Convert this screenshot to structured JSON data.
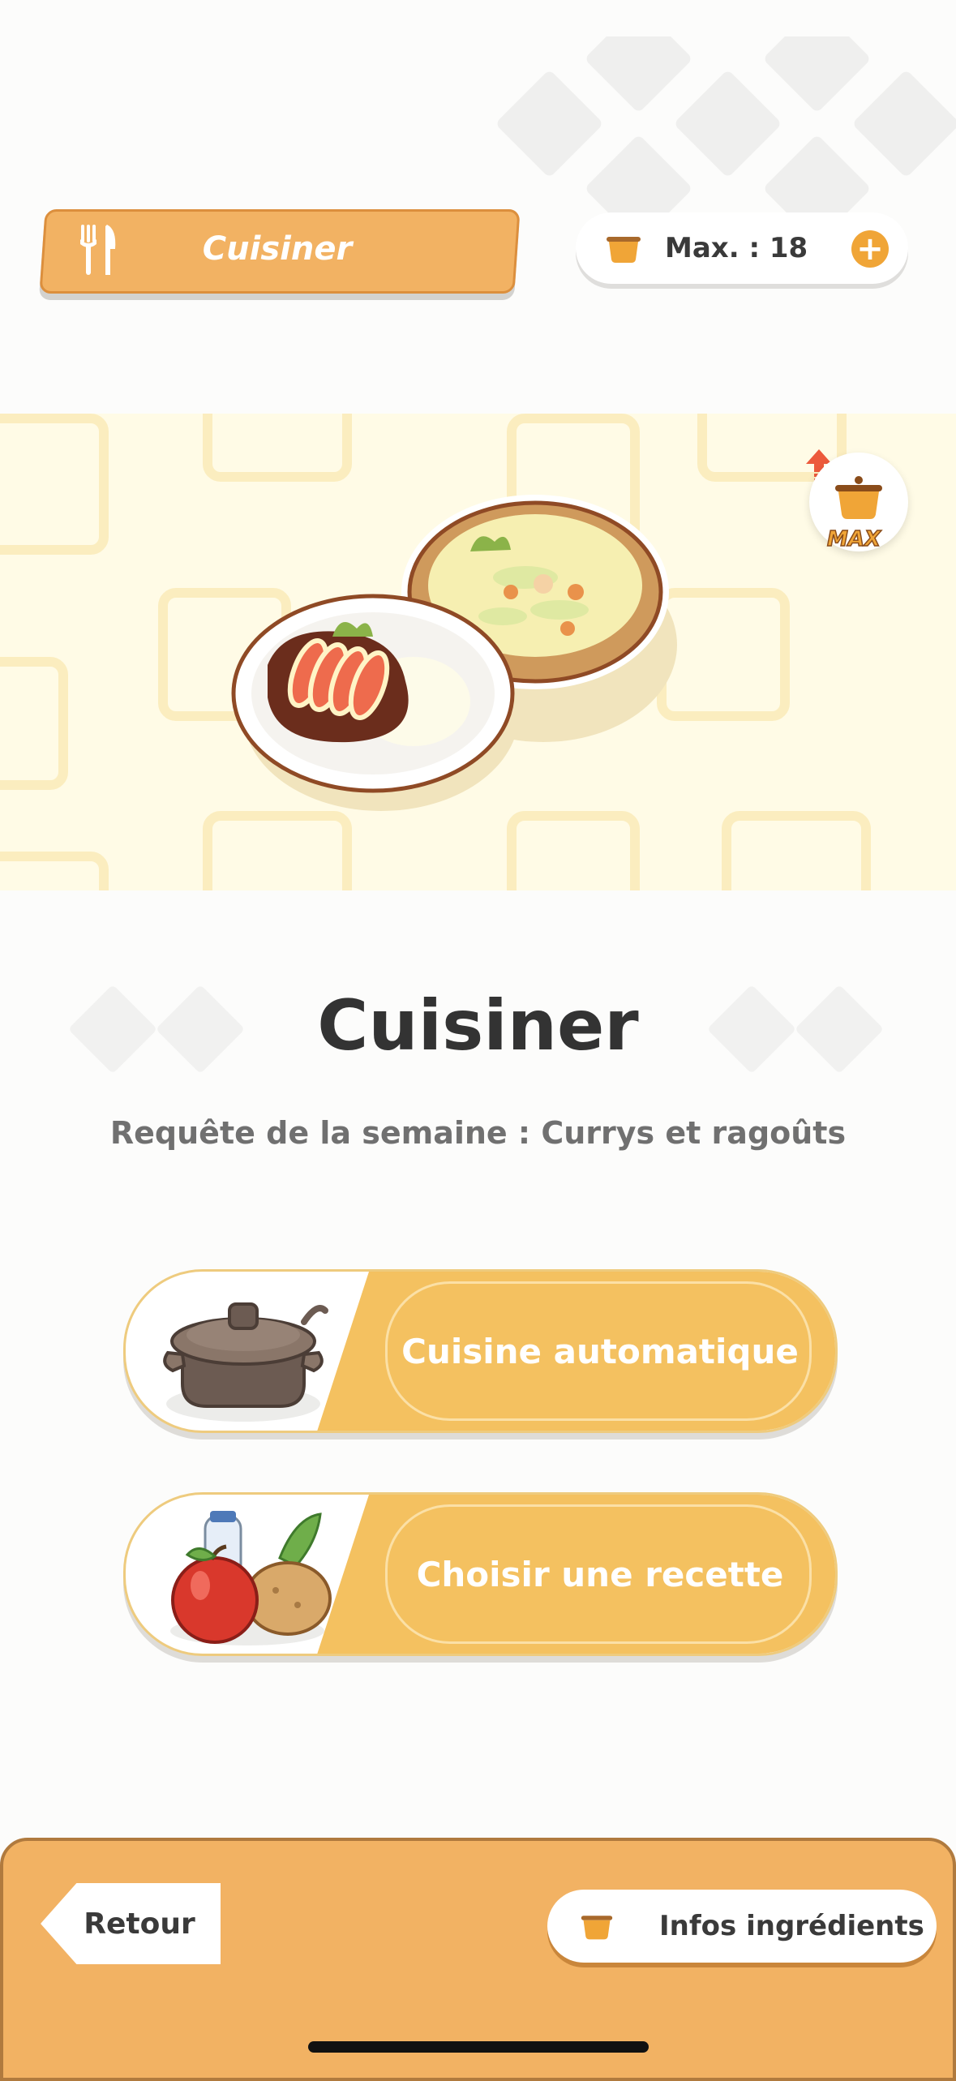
{
  "header": {
    "title": "Cuisiner",
    "max_label": "Max. : 18",
    "plus_label": "+"
  },
  "banner": {
    "max_badge": "MAX"
  },
  "main": {
    "title": "Cuisiner",
    "subtitle": "Requête de la semaine : Currys et ragoûts"
  },
  "actions": [
    {
      "label": "Cuisine automatique"
    },
    {
      "label": "Choisir une recette"
    }
  ],
  "footer": {
    "back_label": "Retour",
    "info_label": "Infos ingrédients"
  },
  "colors": {
    "accent": "#f2b263",
    "button_fill": "#f4c160",
    "plus": "#f0a537"
  }
}
